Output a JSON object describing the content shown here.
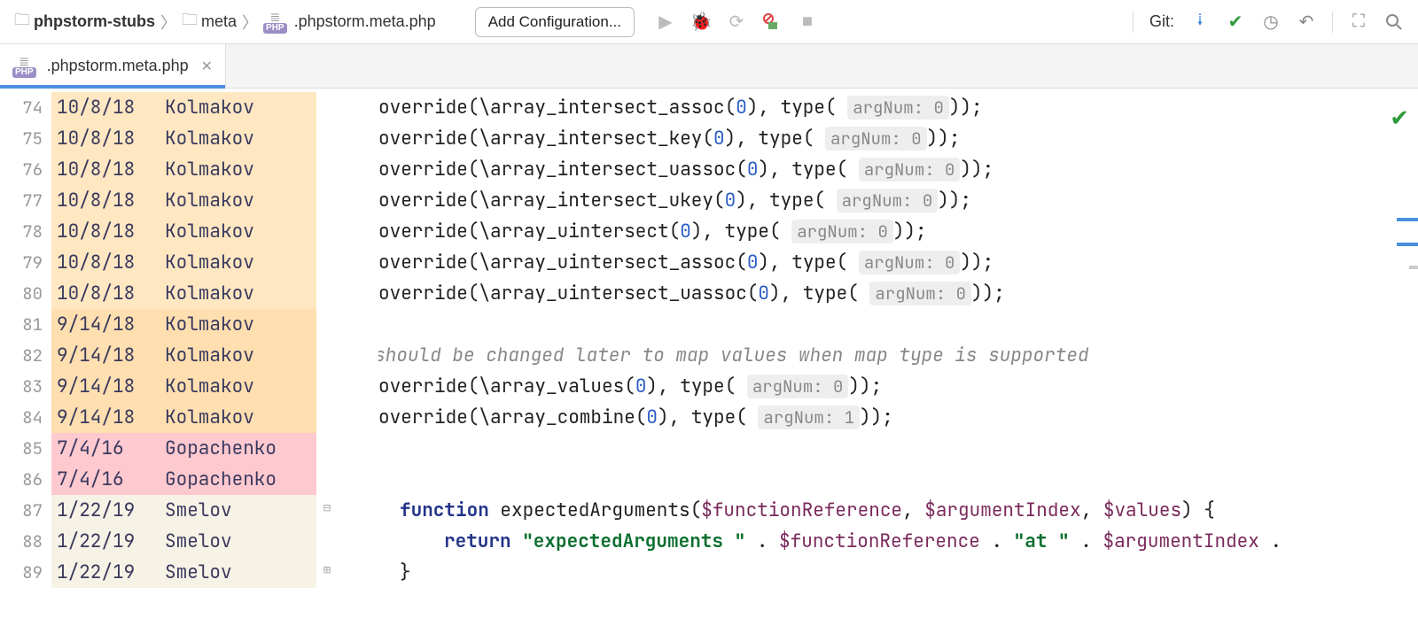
{
  "breadcrumb": {
    "root": "phpstorm-stubs",
    "mid": "meta",
    "file": ".phpstorm.meta.php"
  },
  "add_config": "Add Configuration...",
  "git_label": "Git:",
  "tab": {
    "name": ".phpstorm.meta.php"
  },
  "gutter": [
    {
      "n": 74,
      "d": "10/8/18",
      "a": "Kolmakov",
      "cls": "kol"
    },
    {
      "n": 75,
      "d": "10/8/18",
      "a": "Kolmakov",
      "cls": "kol"
    },
    {
      "n": 76,
      "d": "10/8/18",
      "a": "Kolmakov",
      "cls": "kol"
    },
    {
      "n": 77,
      "d": "10/8/18",
      "a": "Kolmakov",
      "cls": "kol"
    },
    {
      "n": 78,
      "d": "10/8/18",
      "a": "Kolmakov",
      "cls": "kol"
    },
    {
      "n": 79,
      "d": "10/8/18",
      "a": "Kolmakov",
      "cls": "kol"
    },
    {
      "n": 80,
      "d": "10/8/18",
      "a": "Kolmakov",
      "cls": "kol"
    },
    {
      "n": 81,
      "d": "9/14/18",
      "a": "Kolmakov",
      "cls": "kol2"
    },
    {
      "n": 82,
      "d": "9/14/18",
      "a": "Kolmakov",
      "cls": "kol2"
    },
    {
      "n": 83,
      "d": "9/14/18",
      "a": "Kolmakov",
      "cls": "kol2"
    },
    {
      "n": 84,
      "d": "9/14/18",
      "a": "Kolmakov",
      "cls": "kol2"
    },
    {
      "n": 85,
      "d": "7/4/16",
      "a": "Gopachenko",
      "cls": "gop"
    },
    {
      "n": 86,
      "d": "7/4/16",
      "a": "Gopachenko",
      "cls": "gop"
    },
    {
      "n": 87,
      "d": "1/22/19",
      "a": "Smelov",
      "cls": "sme"
    },
    {
      "n": 88,
      "d": "1/22/19",
      "a": "Smelov",
      "cls": "sme"
    },
    {
      "n": 89,
      "d": "1/22/19",
      "a": "Smelov",
      "cls": "sme"
    }
  ],
  "code": {
    "l74": {
      "fn": "override(\\array_intersect_assoc(",
      "n1": "0",
      "mid": "), type( ",
      "hint": "argNum:",
      "n2": "0",
      "end": "));"
    },
    "l75": {
      "fn": "override(\\array_intersect_key(",
      "n1": "0",
      "mid": "), type( ",
      "hint": "argNum:",
      "n2": "0",
      "end": "));"
    },
    "l76": {
      "fn": "override(\\array_intersect_uassoc(",
      "n1": "0",
      "mid": "), type( ",
      "hint": "argNum:",
      "n2": "0",
      "end": "));"
    },
    "l77": {
      "fn": "override(\\array_intersect_ukey(",
      "n1": "0",
      "mid": "), type( ",
      "hint": "argNum:",
      "n2": "0",
      "end": "));"
    },
    "l78": {
      "fn": "override(\\array_uintersect(",
      "n1": "0",
      "mid": "), type( ",
      "hint": "argNum:",
      "n2": "0",
      "end": "));"
    },
    "l79": {
      "fn": "override(\\array_uintersect_assoc(",
      "n1": "0",
      "mid": "), type( ",
      "hint": "argNum:",
      "n2": "0",
      "end": "));"
    },
    "l80": {
      "fn": "override(\\array_uintersect_uassoc(",
      "n1": "0",
      "mid": "), type( ",
      "hint": "argNum:",
      "n2": "0",
      "end": "));"
    },
    "l82": "//should be changed later to map values when map type is supported",
    "l83": {
      "fn": "override(\\array_values(",
      "n1": "0",
      "mid": "), type( ",
      "hint": "argNum:",
      "n2": "0",
      "end": "));"
    },
    "l84": {
      "fn": "override(\\array_combine(",
      "n1": "0",
      "mid": "), type( ",
      "hint": "argNum:",
      "n2": "1",
      "end": "));"
    },
    "l87": {
      "kw": "function",
      "name": " expectedArguments(",
      "p1": "$functionReference",
      "c1": ", ",
      "p2": "$argumentIndex",
      "c2": ", ",
      "p3": "$values",
      "end": ") {"
    },
    "l88": {
      "kw": "return",
      "s1": " \"expectedArguments \"",
      "op1": " . ",
      "v1": "$functionReference",
      "op2": " . ",
      "s2": "\"at \"",
      "op3": " . ",
      "v2": "$argumentIndex",
      "op4": " ."
    },
    "l89": "}"
  }
}
